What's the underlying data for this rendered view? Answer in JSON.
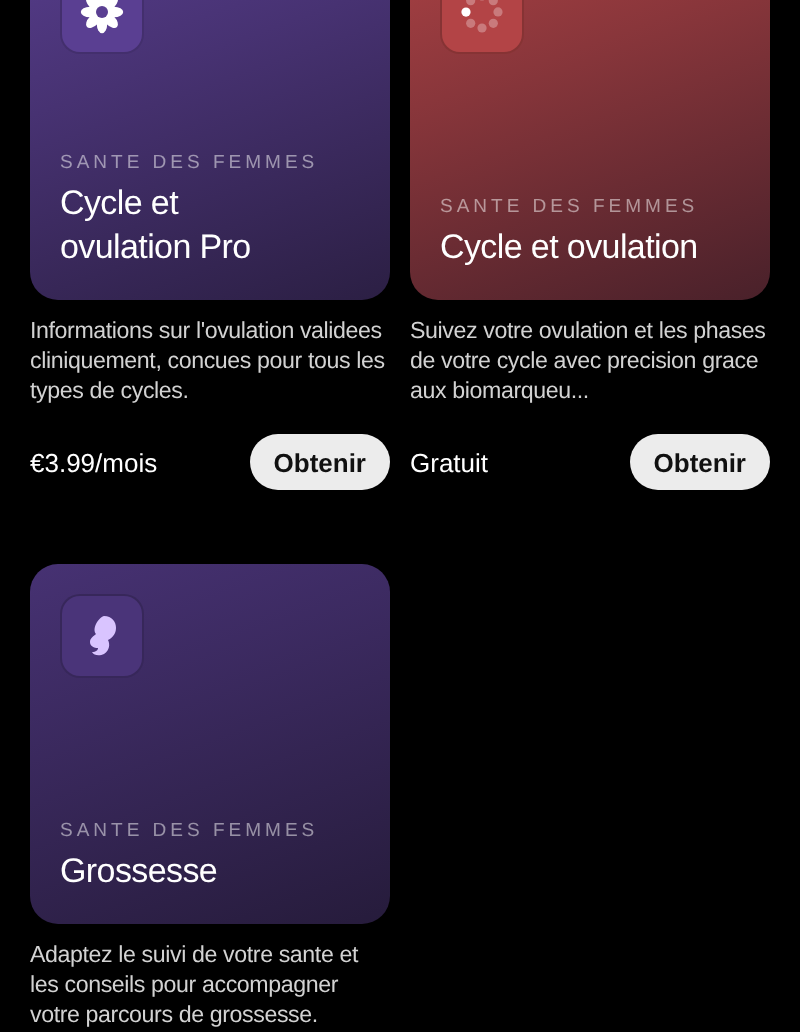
{
  "apps": [
    {
      "category": "SANTE DES FEMMES",
      "title": "Cycle et ovulation Pro",
      "color": "#5a3f92",
      "description": "Informations sur l'ovulation validees cliniquement, concues pour tous les types de cycles.",
      "price": "€3.99/mois",
      "button": "Obtenir"
    },
    {
      "category": "SANTE DES FEMMES",
      "title": "Cycle et ovulation",
      "color": "#b34446",
      "description": "Suivez votre ovulation et les phases de votre cycle avec precision grace aux biomarqueu...",
      "price": "Gratuit",
      "button": "Obtenir"
    },
    {
      "category": "SANTE DES FEMMES",
      "title": "Grossesse",
      "color": "#4a3479",
      "description": "Adaptez le suivi de votre sante et les conseils pour accompagner votre parcours de grossesse."
    }
  ]
}
